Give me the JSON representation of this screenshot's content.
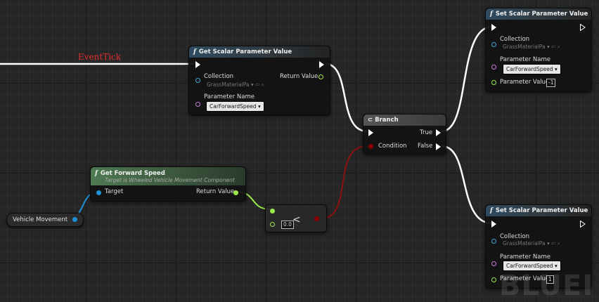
{
  "graph": {
    "event_label": "EventTick",
    "watermark": "BLUEI"
  },
  "nodes": {
    "get_scalar": {
      "title": "Get Scalar Parameter Value",
      "collection_label": "Collection",
      "collection_value": "GrassMaterialPa",
      "return_label": "Return Value",
      "param_label": "Parameter Name",
      "param_value": "CarForwardSpeed"
    },
    "branch": {
      "title": "Branch",
      "true_label": "True",
      "false_label": "False",
      "condition_label": "Condition"
    },
    "get_forward_speed": {
      "title": "Get Forward Speed",
      "subtitle": "Target is Wheeled Vehicle Movement Component",
      "target_label": "Target",
      "return_label": "Return Value"
    },
    "compare": {
      "symbol": "<",
      "value": "0.0"
    },
    "vehicle_movement": {
      "label": "Vehicle Movement"
    },
    "set_scalar_true": {
      "title": "Set Scalar Parameter Value",
      "collection_label": "Collection",
      "collection_value": "GrassMaterialPa",
      "param_label": "Parameter Name",
      "param_value": "CarForwardSpeed",
      "value_label": "Parameter Value",
      "value": "-1"
    },
    "set_scalar_false": {
      "title": "Set Scalar Parameter Value",
      "collection_label": "Collection",
      "collection_value": "GrassMaterialPa",
      "param_label": "Parameter Name",
      "param_value": "CarForwardSpeed",
      "value_label": "Parameter Value",
      "value": "1"
    }
  },
  "colors": {
    "exec_wire": "#ffffff",
    "float_pin": "#9bea4a",
    "bool_pin": "#8b0000",
    "object_pin": "#1e90d8",
    "collection_pin": "#3fa7d6",
    "name_pin": "#c77dd9",
    "event_text": "#e03030"
  }
}
